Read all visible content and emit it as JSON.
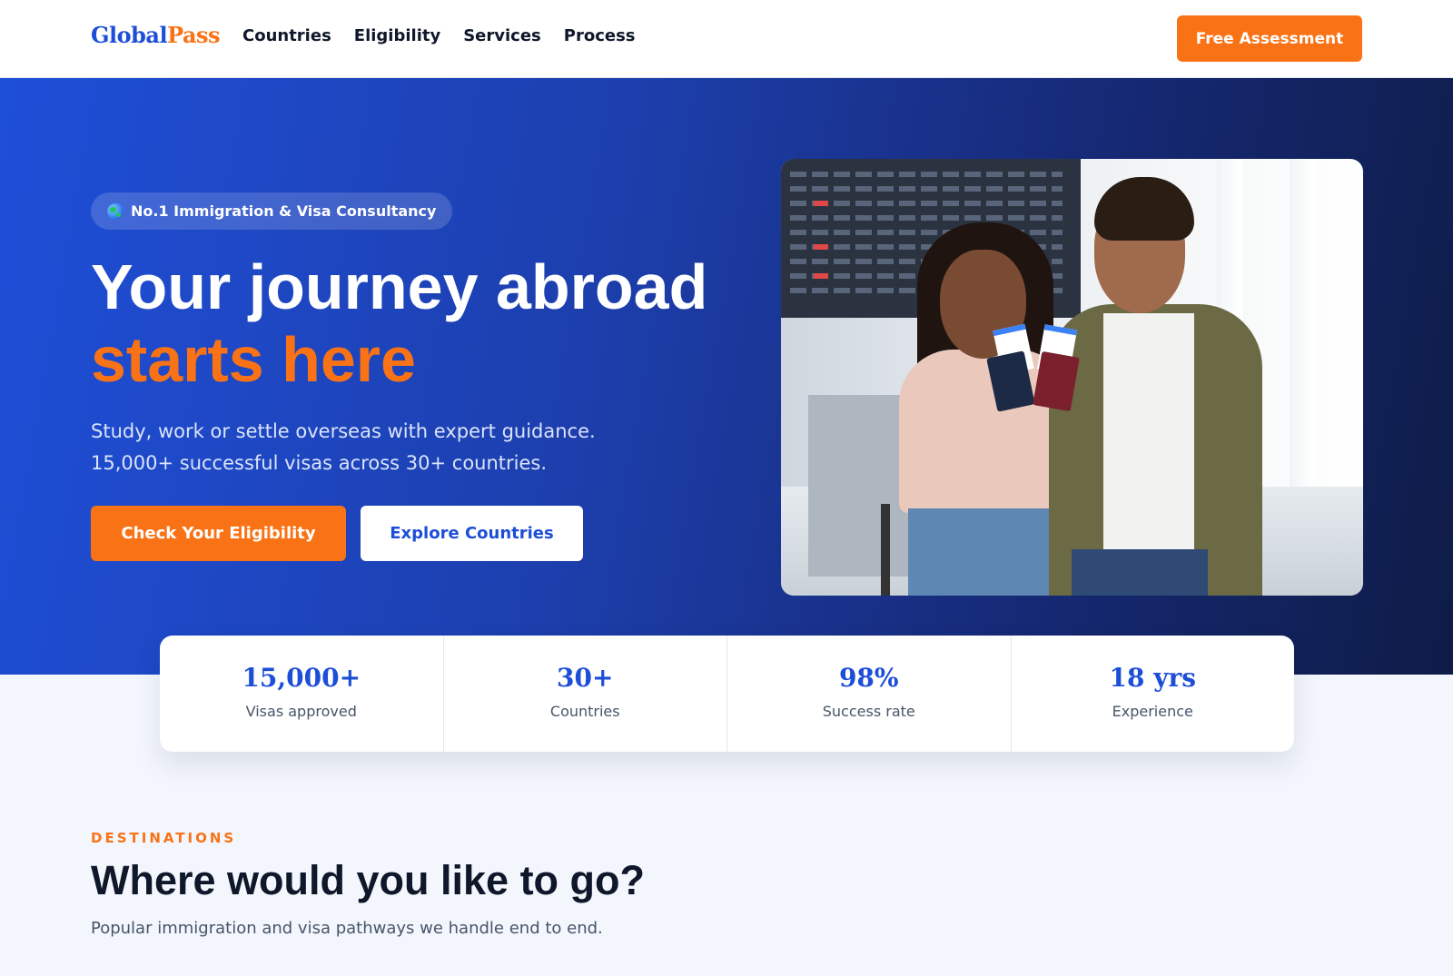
{
  "nav": {
    "logo_part1": "Global",
    "logo_part2": "Pass",
    "links": [
      "Countries",
      "Eligibility",
      "Services",
      "Process"
    ],
    "cta": "Free Assessment"
  },
  "hero": {
    "badge": "No.1 Immigration & Visa Consultancy",
    "badge_icon": "globe-icon",
    "title_line1": "Your journey abroad",
    "title_line2": "starts here",
    "subtitle_line1": "Study, work or settle overseas with expert guidance.",
    "subtitle_line2": "15,000+ successful visas across 30+ countries.",
    "primary_button": "Check Your Eligibility",
    "secondary_button": "Explore Countries"
  },
  "stats": [
    {
      "value": "15,000+",
      "label": "Visas approved"
    },
    {
      "value": "30+",
      "label": "Countries"
    },
    {
      "value": "98%",
      "label": "Success rate"
    },
    {
      "value": "18 yrs",
      "label": "Experience"
    }
  ],
  "destinations": {
    "eyebrow": "DESTINATIONS",
    "title": "Where would you like to go?",
    "subtitle": "Popular immigration and visa pathways we handle end to end."
  },
  "colors": {
    "brand_blue": "#1d4ed8",
    "accent_orange": "#f97316",
    "hero_dark": "#0f1c47"
  }
}
